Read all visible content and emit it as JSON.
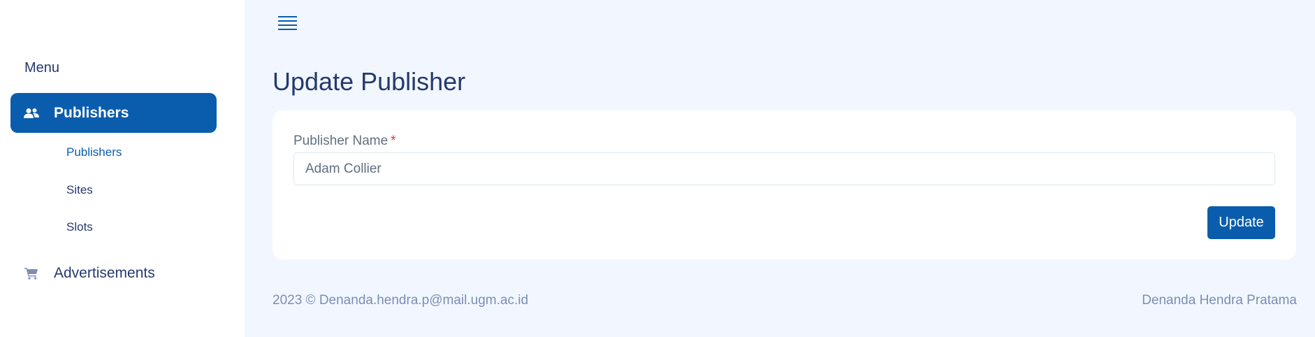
{
  "sidebar": {
    "menu_title": "Menu",
    "items": [
      {
        "label": "Publishers",
        "icon": "people-icon",
        "active": true
      },
      {
        "label": "Advertisements",
        "icon": "cart-icon",
        "active": false
      }
    ],
    "sub_items": [
      {
        "label": "Publishers",
        "active": true
      },
      {
        "label": "Sites",
        "active": false
      },
      {
        "label": "Slots",
        "active": false
      }
    ]
  },
  "header": {
    "menu_toggle_icon": "hamburger-icon"
  },
  "main": {
    "title": "Update Publisher",
    "form": {
      "name_label": "Publisher Name",
      "required_mark": "*",
      "name_value": "Adam Collier",
      "submit_label": "Update"
    }
  },
  "footer": {
    "left": "2023 © Denanda.hendra.p@mail.ugm.ac.id",
    "right": "Denanda Hendra Pratama"
  },
  "colors": {
    "primary": "#0a5dad",
    "background": "#f2f7ff",
    "text": "#25396f",
    "muted": "#7c8db5",
    "required": "#dc3545"
  }
}
